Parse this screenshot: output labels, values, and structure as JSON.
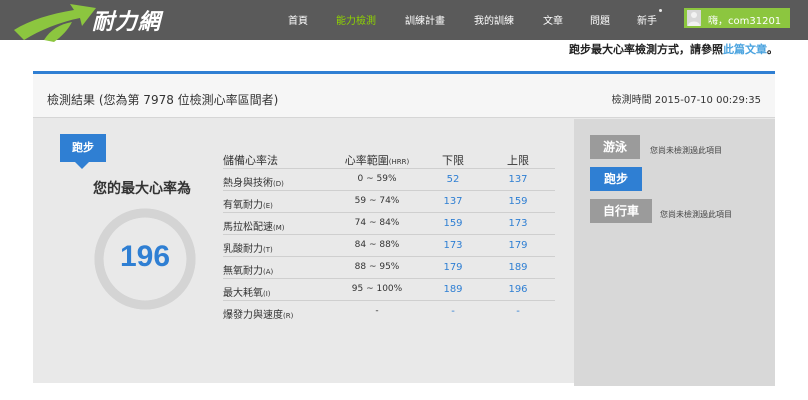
{
  "logo": {
    "text": "耐力網"
  },
  "nav": {
    "items": [
      {
        "label": "首頁",
        "active": false
      },
      {
        "label": "能力檢測",
        "active": true
      },
      {
        "label": "訓練計畫",
        "active": false
      },
      {
        "label": "我的訓練",
        "active": false
      },
      {
        "label": "文章",
        "active": false
      },
      {
        "label": "問題",
        "active": false
      },
      {
        "label": "新手",
        "active": false
      }
    ],
    "user": "嗨，com31201"
  },
  "info": {
    "prefix": "跑步最大心率檢測方式，請參照",
    "link": "此篇文章",
    "suffix": "。"
  },
  "panel": {
    "title": "檢測結果 (您為第 7978 位檢測心率區間者)",
    "time": "檢測時間 2015-07-10 00:29:35"
  },
  "result": {
    "badge": "跑步",
    "label": "您的最大心率為",
    "value": "196",
    "gauge_fraction": 1.0
  },
  "table": {
    "headers": {
      "name": "儲備心率法",
      "range": "心率範圍",
      "range_unit": "(HRR)",
      "low": "下限",
      "high": "上限"
    },
    "rows": [
      {
        "name": "熱身與技術",
        "code": "(D)",
        "range": "0 ~ 59%",
        "low": "52",
        "high": "137"
      },
      {
        "name": "有氧耐力",
        "code": "(E)",
        "range": "59 ~ 74%",
        "low": "137",
        "high": "159"
      },
      {
        "name": "馬拉松配速",
        "code": "(M)",
        "range": "74 ~ 84%",
        "low": "159",
        "high": "173"
      },
      {
        "name": "乳酸耐力",
        "code": "(T)",
        "range": "84 ~ 88%",
        "low": "173",
        "high": "179"
      },
      {
        "name": "無氧耐力",
        "code": "(A)",
        "range": "88 ~ 95%",
        "low": "179",
        "high": "189"
      },
      {
        "name": "最大耗氧",
        "code": "(I)",
        "range": "95 ~ 100%",
        "low": "189",
        "high": "196"
      },
      {
        "name": "爆發力與速度",
        "code": "(R)",
        "range": "-",
        "low": "-",
        "high": "-"
      }
    ]
  },
  "sports": {
    "swim": {
      "label": "游泳",
      "note": "您尚未檢測過此項目"
    },
    "run": {
      "label": "跑步"
    },
    "bike": {
      "label": "自行車",
      "note": "您尚未檢測過此項目"
    }
  },
  "colors": {
    "accent": "#2f7fd3",
    "nav_active": "#8fd400",
    "user_chip": "#8cc63f",
    "logo_green": "#8cc63f"
  }
}
